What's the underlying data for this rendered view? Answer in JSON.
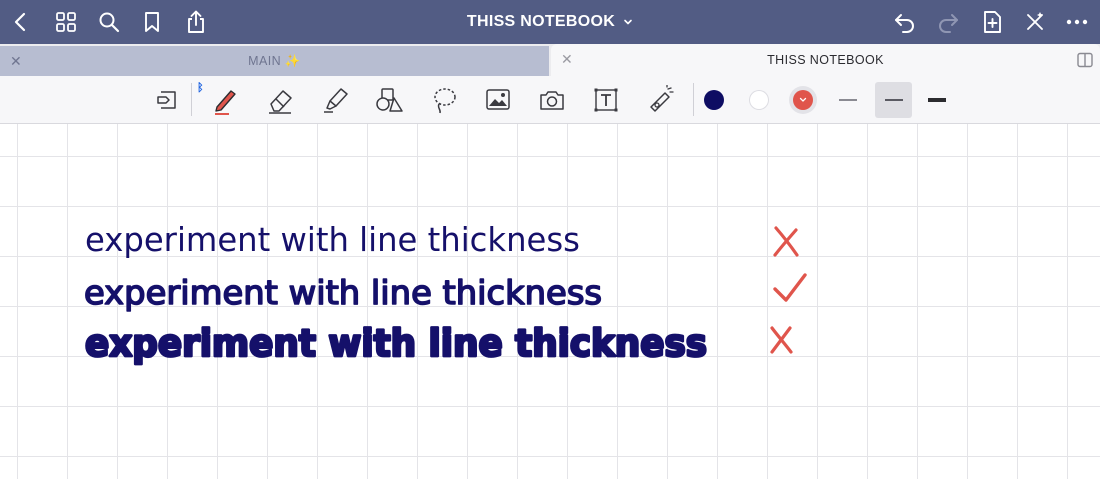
{
  "header": {
    "title": "THISS NOTEBOOK"
  },
  "tabs": [
    {
      "label": "MAIN ✨",
      "active": false
    },
    {
      "label": "THISS NOTEBOOK",
      "active": true
    }
  ],
  "icons": {
    "back": "chevron-left-icon",
    "grid": "grid-icon",
    "search": "search-icon",
    "bookmark": "bookmark-icon",
    "share": "share-icon",
    "undo": "undo-icon",
    "redo": "redo-icon",
    "add_page": "add-page-icon",
    "close_toolbar": "close-toolbar-icon",
    "more": "more-icon",
    "split_view": "split-view-icon"
  },
  "toolbar": {
    "tools": [
      "read-only-mode",
      "pen",
      "eraser",
      "highlighter",
      "shapes",
      "lasso",
      "image",
      "camera",
      "text",
      "laser-pointer"
    ],
    "bluetooth": true,
    "colors": [
      "#0e0d63",
      "#ffffff",
      "#e0554c"
    ],
    "selected_color": "#e0554c",
    "stroke_sizes": [
      "thin",
      "medium",
      "thick"
    ],
    "selected_stroke": "medium"
  },
  "colors": {
    "topbar": "#525c84",
    "ink": "#15106a",
    "mark": "#e0554c"
  },
  "notes": [
    {
      "text": "experiment with line thickness",
      "weight": "thin",
      "mark": "✗"
    },
    {
      "text": "experiment with line thickness",
      "weight": "medium",
      "mark": "✓"
    },
    {
      "text": "experiment with line thickness",
      "weight": "thick",
      "mark": "✗"
    }
  ]
}
